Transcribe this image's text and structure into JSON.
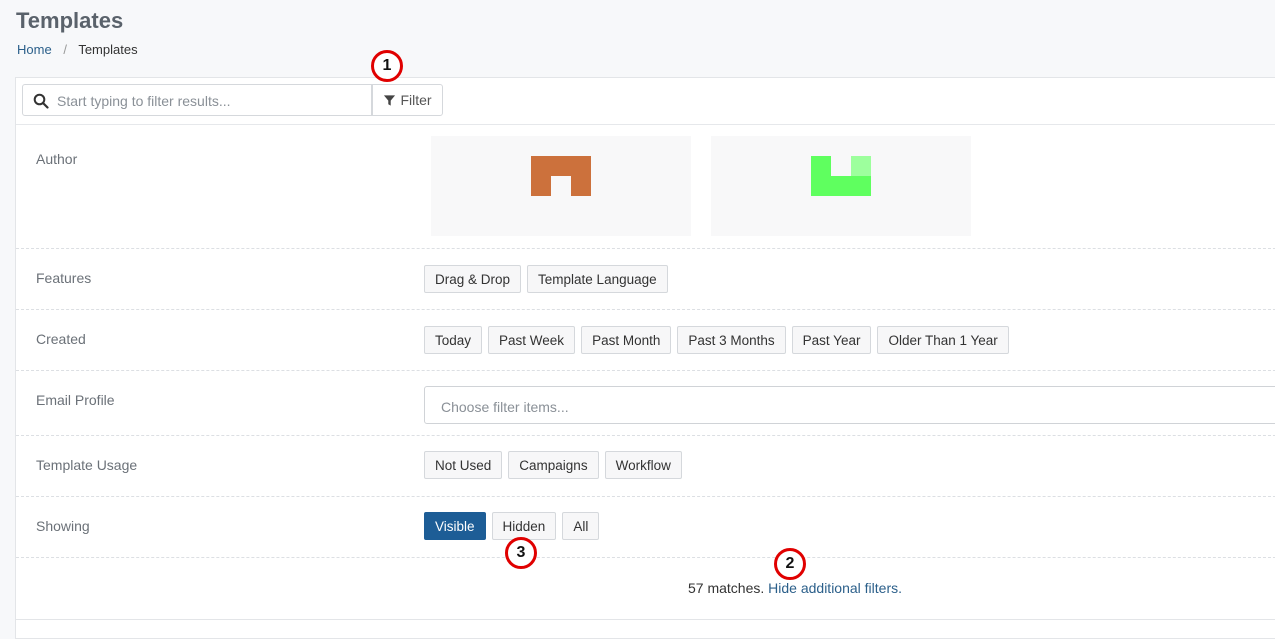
{
  "header": {
    "title": "Templates",
    "breadcrumb": [
      {
        "label": "Home"
      },
      {
        "label": "Templates"
      }
    ]
  },
  "toolbar": {
    "search_placeholder": "Start typing to filter results...",
    "filter_label": "Filter"
  },
  "filters": {
    "author": {
      "label": "Author",
      "avatars": [
        {
          "color": "#cc713c",
          "icon": "author-identicon"
        },
        {
          "color": "#5fff5f",
          "accent": "#9dff9d",
          "icon": "author-identicon"
        }
      ]
    },
    "features": {
      "label": "Features",
      "options": [
        "Drag & Drop",
        "Template Language"
      ]
    },
    "created": {
      "label": "Created",
      "options": [
        "Today",
        "Past Week",
        "Past Month",
        "Past 3 Months",
        "Past Year",
        "Older Than 1 Year"
      ]
    },
    "email_profile": {
      "label": "Email Profile",
      "placeholder": "Choose filter items..."
    },
    "usage": {
      "label": "Template Usage",
      "options": [
        "Not Used",
        "Campaigns",
        "Workflow"
      ]
    },
    "showing": {
      "label": "Showing",
      "options": [
        "Visible",
        "Hidden",
        "All"
      ],
      "active": "Visible"
    }
  },
  "results": {
    "count_text": "57 matches.",
    "hide_filters_label": "Hide additional filters."
  },
  "annotations": [
    "1",
    "2",
    "3"
  ],
  "colors": {
    "accent": "#1d5d96",
    "link": "#2b5f8a",
    "marker": "#e00000"
  }
}
